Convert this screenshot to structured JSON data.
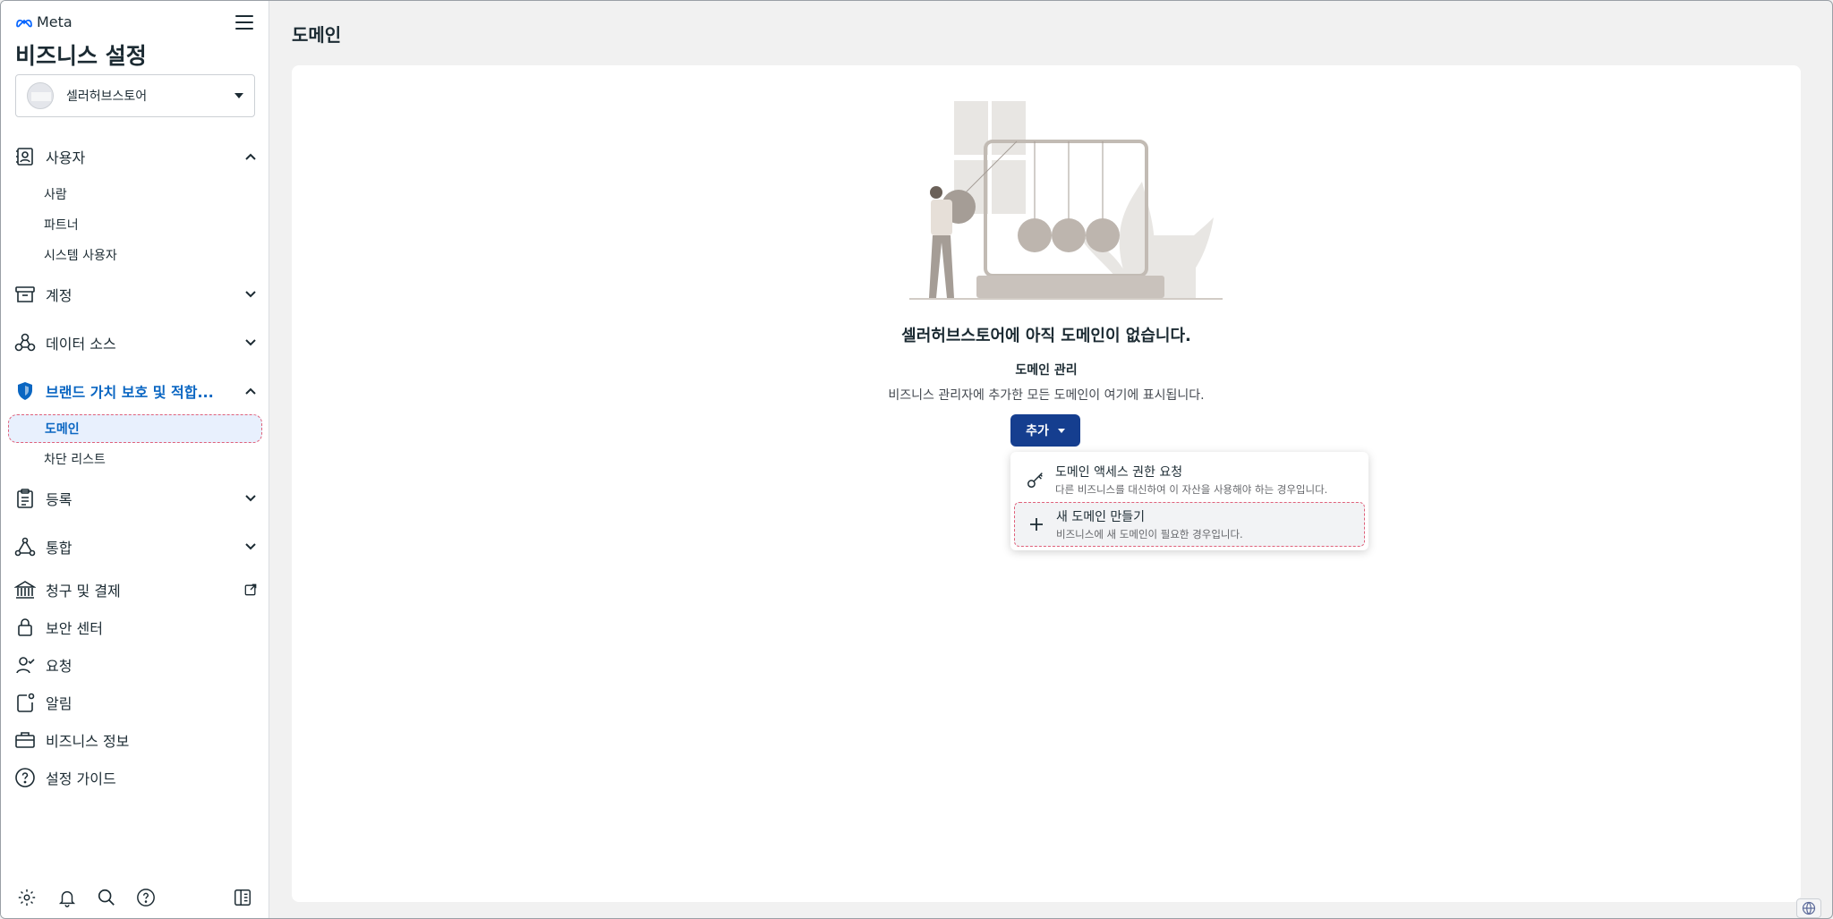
{
  "sidebar": {
    "brand": "Meta",
    "title": "비즈니스 설정",
    "business_name": "셀러허브스토어",
    "nav": {
      "users": "사용자",
      "users_people": "사람",
      "users_partners": "파트너",
      "users_system": "시스템 사용자",
      "accounts": "계정",
      "data_sources": "데이터 소스",
      "brand_safety": "브랜드 가치 보호 및 적합...",
      "domains": "도메인",
      "block_lists": "차단 리스트",
      "registrations": "등록",
      "integrations": "통합",
      "billing": "청구 및 결제",
      "security_center": "보안 센터",
      "requests": "요청",
      "notifications": "알림",
      "business_info": "비즈니스 정보",
      "setup_guide": "설정 가이드"
    }
  },
  "main": {
    "page_title": "도메인",
    "empty_title": "셀러허브스토어에 아직 도메인이 없습니다.",
    "empty_subtitle": "도메인 관리",
    "empty_description": "비즈니스 관리자에 추가한 모든 도메인이 여기에 표시됩니다.",
    "add_button": "추가",
    "dropdown": [
      {
        "title": "도메인 액세스 권한 요청",
        "desc": "다른 비즈니스를 대신하여 이 자산을 사용해야 하는 경우입니다."
      },
      {
        "title": "새 도메인 만들기",
        "desc": "비즈니스에 새 도메인이 필요한 경우입니다."
      }
    ]
  },
  "colors": {
    "accent": "#0a66c2",
    "button": "#153e8f",
    "highlight_border": "#e0607a"
  }
}
